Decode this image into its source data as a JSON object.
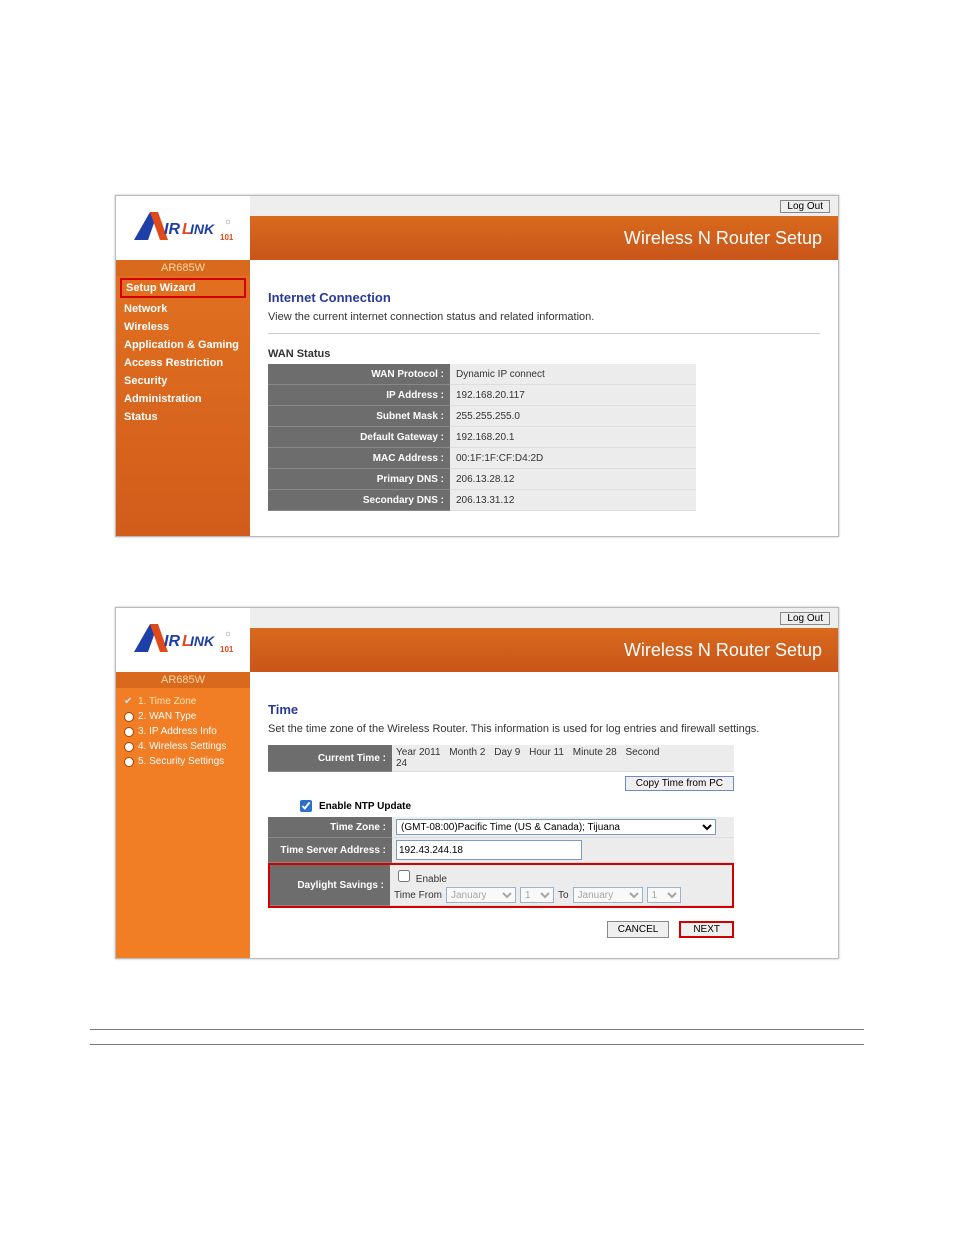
{
  "brand": {
    "name": "AirLink101",
    "model": "AR685W",
    "banner_title": "Wireless N Router Setup",
    "logout": "Log Out"
  },
  "screen1": {
    "nav": {
      "setup_wizard": "Setup Wizard",
      "network": "Network",
      "wireless": "Wireless",
      "app_gaming": "Application & Gaming",
      "access_restriction": "Access Restriction",
      "security": "Security",
      "administration": "Administration",
      "status": "Status"
    },
    "title": "Internet Connection",
    "desc": "View the current internet connection status and related information.",
    "section": "WAN Status",
    "rows": [
      {
        "label": "WAN Protocol :",
        "value": "Dynamic IP connect"
      },
      {
        "label": "IP Address :",
        "value": "192.168.20.117"
      },
      {
        "label": "Subnet Mask :",
        "value": "255.255.255.0"
      },
      {
        "label": "Default Gateway :",
        "value": "192.168.20.1"
      },
      {
        "label": "MAC Address :",
        "value": "00:1F:1F:CF:D4:2D"
      },
      {
        "label": "Primary DNS :",
        "value": "206.13.28.12"
      },
      {
        "label": "Secondary DNS :",
        "value": "206.13.31.12"
      }
    ]
  },
  "screen2": {
    "steps": {
      "s1": "1. Time Zone",
      "s2": "2. WAN Type",
      "s3": "3. IP Address Info",
      "s4": "4. Wireless Settings",
      "s5": "5. Security Settings"
    },
    "title": "Time",
    "desc": "Set the time zone of the Wireless Router. This information is used for log entries and firewall settings.",
    "labels": {
      "current_time": "Current Time :",
      "enable_ntp": "Enable NTP Update",
      "time_zone": "Time Zone :",
      "time_server": "Time Server Address :",
      "daylight": "Daylight Savings :",
      "copy_from_pc": "Copy Time from PC",
      "year": "Year",
      "month": "Month",
      "day": "Day",
      "hour": "Hour",
      "minute": "Minute",
      "second": "Second",
      "enable": "Enable",
      "time_from": "Time From",
      "to": "To",
      "cancel": "CANCEL",
      "next": "NEXT"
    },
    "values": {
      "year": "2011",
      "month": "2",
      "day": "9",
      "hour": "11",
      "minute": "28",
      "second": "24",
      "ntp_enabled": true,
      "time_zone_selected": "(GMT-08:00)Pacific Time (US & Canada); Tijuana",
      "time_server": "192.43.244.18",
      "daylight_enabled": false,
      "ds_from_month": "January",
      "ds_from_day": "1",
      "ds_to_month": "January",
      "ds_to_day": "1"
    }
  }
}
